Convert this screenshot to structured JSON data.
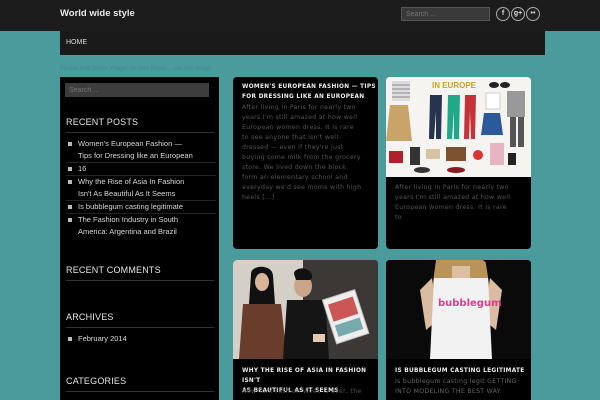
{
  "site": {
    "title": "World wide style",
    "tagline": "Please Add Some Images to Your Posts... use this image"
  },
  "header": {
    "search_placeholder": "Search ...",
    "social": [
      {
        "name": "facebook-icon",
        "glyph": "f"
      },
      {
        "name": "google-plus-icon",
        "glyph": "g+"
      },
      {
        "name": "flickr-icon",
        "glyph": "••"
      }
    ]
  },
  "nav": {
    "home_label": "HOME"
  },
  "sidebar": {
    "search_placeholder": "Search ...",
    "recent_posts_title": "RECENT POSTS",
    "recent_posts": [
      "Women's European Fashion —",
      "Tips for Dressing like an European",
      "16",
      "Why the Rise of Asia In Fashion",
      "Isn't As Beautiful As It Seems",
      "Is bubblegum casting legitimate",
      "The Fashion Industry in South",
      "America: Argentina and Brazil"
    ],
    "recent_comments_title": "RECENT COMMENTS",
    "archives_title": "ARCHIVES",
    "archives": [
      "February 2014"
    ],
    "categories_title": "CATEGORIES"
  },
  "posts": [
    {
      "title_lines": [
        "WOMEN'S EUROPEAN FASHION — TIPS",
        "FOR DRESSING LIKE AN EUROPEAN"
      ],
      "excerpt_lines": [
        "After living in Paris for nearly two",
        "years I'm still amazed at how well",
        "European women dress. It is rare",
        "to see anyone that isn't well-",
        "dressed — even if they're just",
        "buying some milk from the grocery",
        "store. We lived down the block",
        "form an elementary school and",
        "everyday we'd see moms with high",
        "heels [...]"
      ]
    },
    {
      "image_caption": "IN EUROPE",
      "excerpt_lines": [
        "After living in Paris for nearly two",
        "years I'm still amazed at how well",
        "European women dress. It is rare",
        "to"
      ]
    },
    {
      "title_lines": [
        "WHY THE RISE OF ASIA IN FASHION ISN'T",
        "AS BEAUTIFUL AS IT SEEMS"
      ],
      "excerpt_lines": [
        "New York Fashion Week is over, the"
      ]
    },
    {
      "shirt_text": "bubblegum",
      "title_lines": [
        "IS BUBBLEGUM CASTING LEGITIMATE"
      ],
      "excerpt_lines": [
        "Is bubblegum casting legit GETTING",
        "INTO MODELING THE BEST WAY"
      ]
    }
  ]
}
